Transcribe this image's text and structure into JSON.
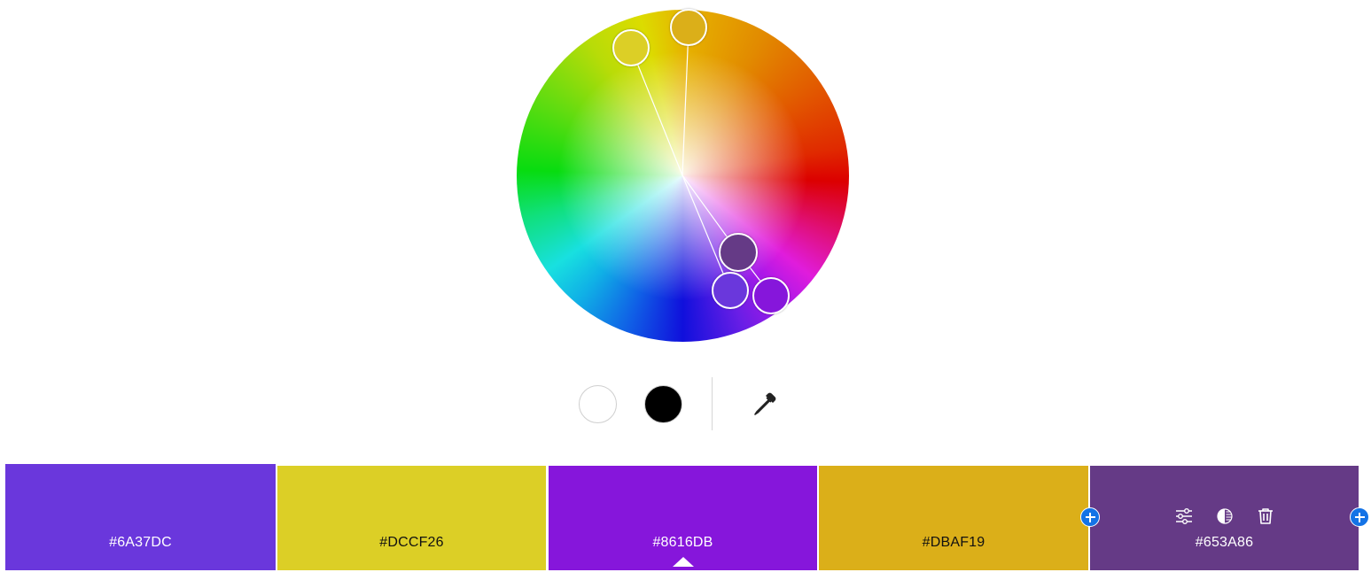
{
  "wheel": {
    "handles": [
      {
        "name": "handle-base",
        "color": "#653A86",
        "role": "base"
      },
      {
        "name": "handle-1",
        "color": "#DCCF26"
      },
      {
        "name": "handle-2",
        "color": "#DBAF19"
      },
      {
        "name": "handle-3",
        "color": "#6A37DC"
      },
      {
        "name": "handle-4",
        "color": "#8616DB"
      }
    ]
  },
  "tools": {
    "white_swatch": "white-swatch",
    "black_swatch": "black-swatch",
    "eyedropper": "eyedropper-icon"
  },
  "palette": {
    "swatches": [
      {
        "hex": "#6A37DC",
        "color": "#6A37DC",
        "text_color": "#ffffff"
      },
      {
        "hex": "#DCCF26",
        "color": "#DCCF26",
        "text_color": "#111111"
      },
      {
        "hex": "#8616DB",
        "color": "#8616DB",
        "text_color": "#ffffff",
        "selected": true
      },
      {
        "hex": "#DBAF19",
        "color": "#DBAF19",
        "text_color": "#111111"
      },
      {
        "hex": "#653A86",
        "color": "#653A86",
        "text_color": "#ffffff",
        "base": true
      }
    ],
    "cell_tools": [
      "sliders-icon",
      "contrast-icon",
      "trash-icon"
    ],
    "add_icon": "plus-icon"
  }
}
